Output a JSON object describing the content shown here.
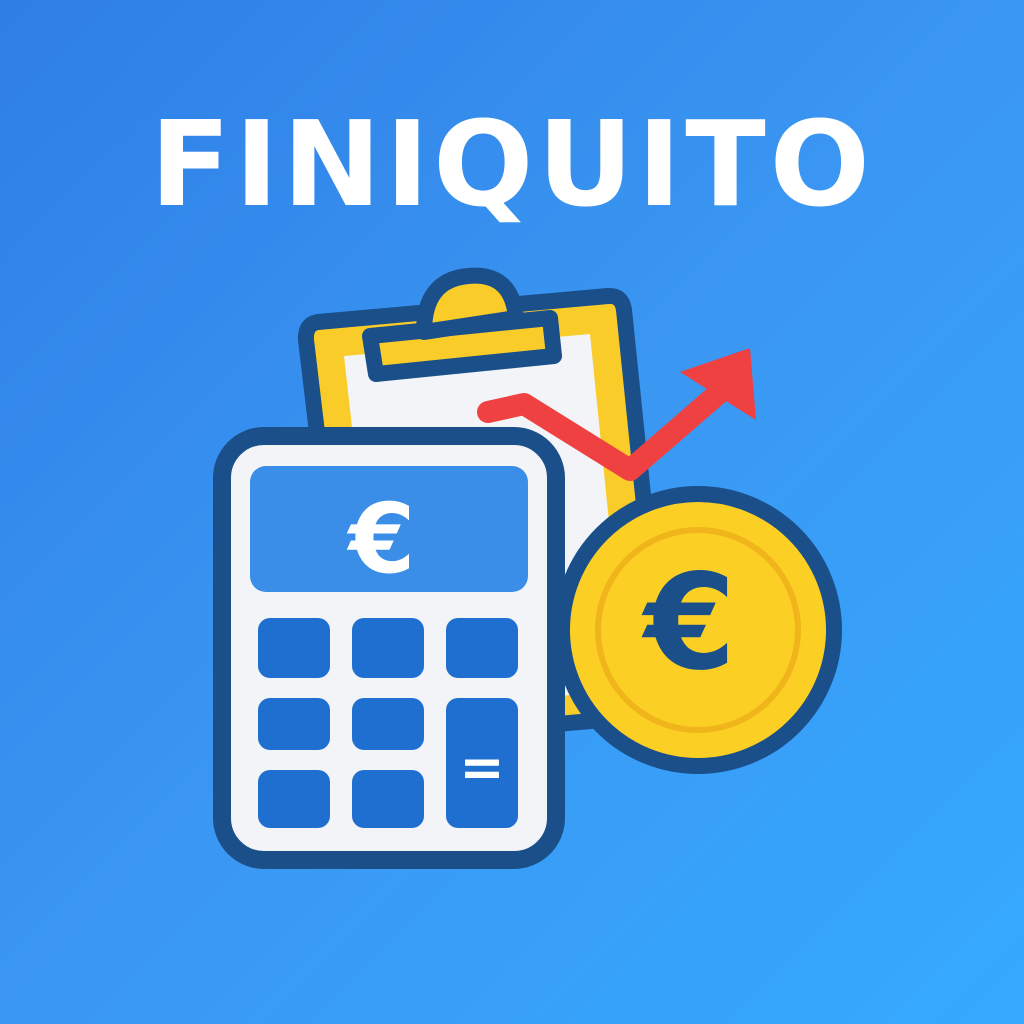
{
  "app": {
    "title": "FINIQUITO"
  },
  "calculator": {
    "display_symbol": "€",
    "equals_symbol": "="
  },
  "coin": {
    "symbol": "€"
  },
  "colors": {
    "background_start": "#2f7ee6",
    "background_end": "#35aaff",
    "outline": "#1a4f8a",
    "calculator_body": "#f2f4f7",
    "calculator_display": "#3a8ee8",
    "calculator_keys": "#1f6fd0",
    "clipboard_yellow": "#f9cc2a",
    "coin_gold": "#fccf25",
    "arrow_red": "#ef4141",
    "title_text": "#ffffff"
  },
  "icons": [
    "clipboard-icon",
    "trend-up-arrow-icon",
    "calculator-icon",
    "euro-coin-icon"
  ]
}
